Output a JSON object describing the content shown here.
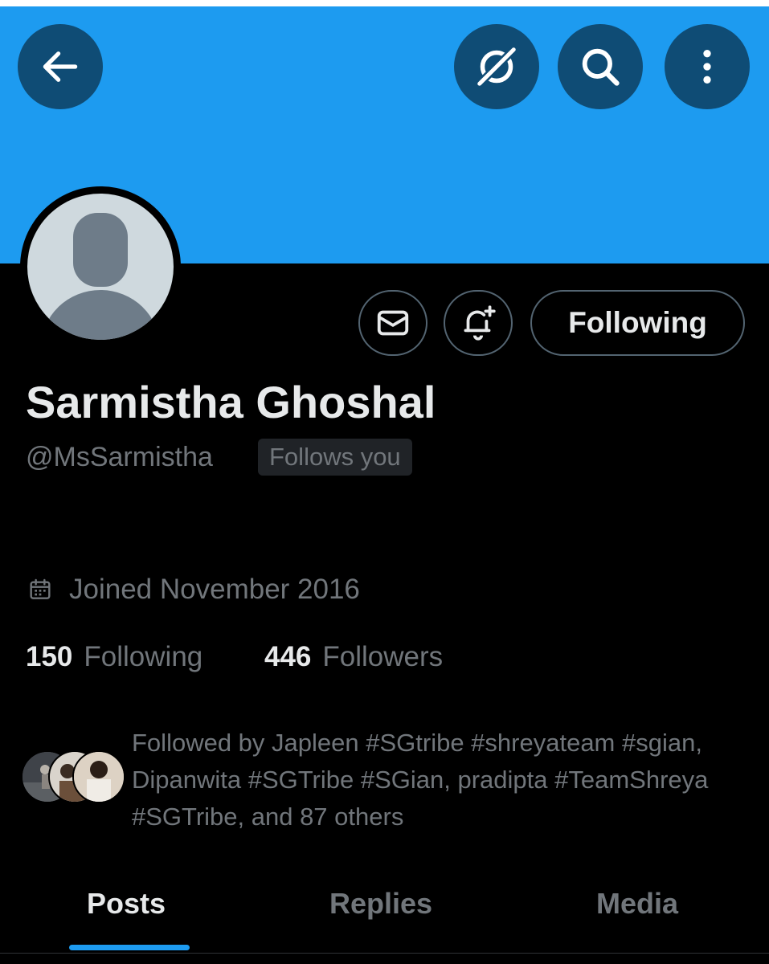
{
  "header": {
    "back_icon": "arrow-left-icon",
    "grok_icon": "grok-slash-circle-icon",
    "search_icon": "search-icon",
    "more_icon": "more-vertical-icon",
    "banner_color": "#1d9bf0"
  },
  "profile": {
    "display_name": "Sarmistha Ghoshal",
    "handle": "@MsSarmistha",
    "follows_you_badge": "Follows you",
    "joined": "Joined November 2016",
    "following_count": "150",
    "following_label": "Following",
    "followers_count": "446",
    "followers_label": "Followers"
  },
  "actions": {
    "message_icon": "envelope-icon",
    "notify_icon": "bell-plus-icon",
    "following_button": "Following"
  },
  "followed_by": {
    "text": "Followed by Japleen #SGtribe #shreyateam #sgian, Dipanwita #SGTribe #SGian, pradipta #TeamShreya #SGTribe, and 87 others"
  },
  "tabs": [
    {
      "label": "Posts",
      "active": true
    },
    {
      "label": "Replies",
      "active": false
    },
    {
      "label": "Media",
      "active": false
    }
  ],
  "colors": {
    "accent": "#1d9bf0",
    "primary_text": "#e7e9ea",
    "secondary_text": "#71767b"
  }
}
